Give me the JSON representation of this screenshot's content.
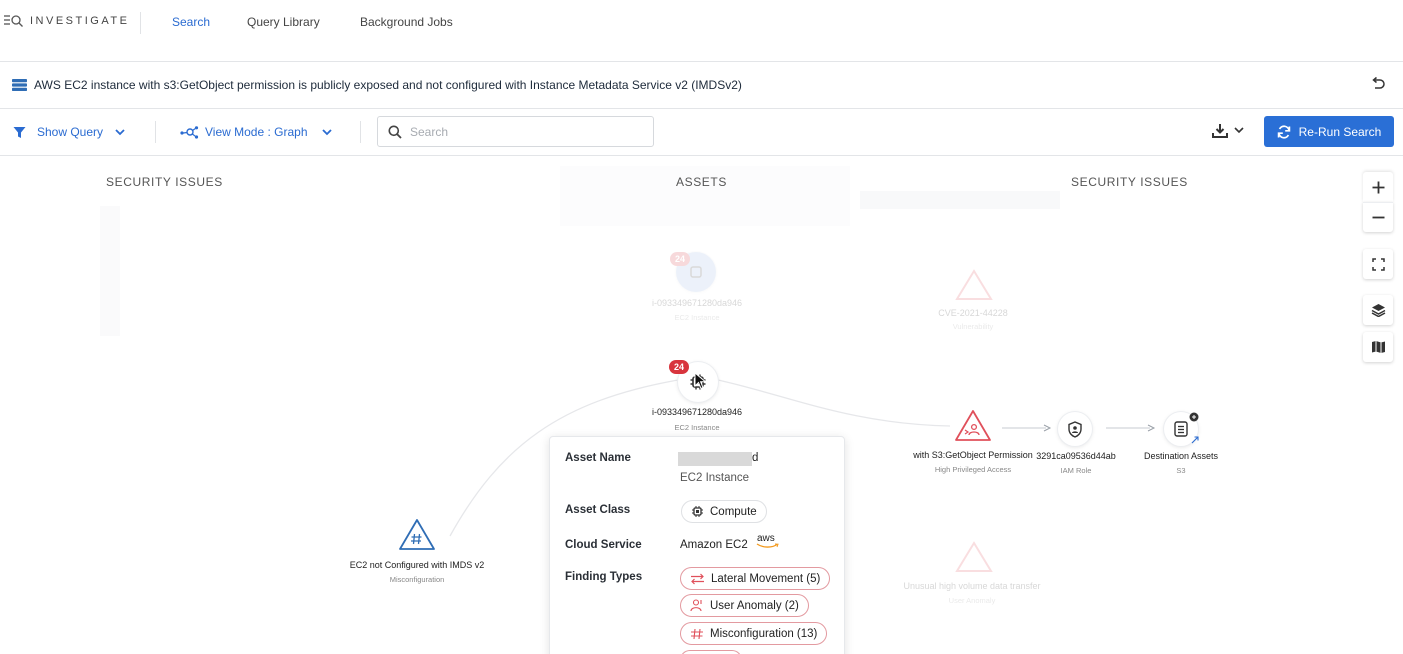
{
  "nav": {
    "brand": "INVESTIGATE",
    "tabs": [
      {
        "label": "Search",
        "active": true
      },
      {
        "label": "Query Library",
        "active": false
      },
      {
        "label": "Background Jobs",
        "active": false
      }
    ]
  },
  "title": {
    "text": "AWS EC2 instance with s3:GetObject permission is publicly exposed and not configured with Instance Metadata Service v2 (IMDSv2)"
  },
  "toolbar": {
    "show_query": "Show Query",
    "view_mode": "View Mode : Graph",
    "search_placeholder": "Search",
    "rerun_label": "Re-Run Search"
  },
  "columns": {
    "left": "SECURITY ISSUES",
    "center": "ASSETS",
    "right": "SECURITY ISSUES"
  },
  "graph": {
    "main_asset": {
      "badge": "24",
      "name": "i-093349671280da946",
      "type": "EC2 Instance"
    },
    "misconfig": {
      "name": "EC2 not Configured with IMDS v2",
      "type": "Misconfiguration"
    },
    "privilege": {
      "name": "with S3:GetObject Permission",
      "type": "High Privileged Access"
    },
    "iam_role": {
      "name": "3291ca09536d44ab",
      "type": "IAM Role"
    },
    "destination": {
      "name": "Destination Assets",
      "type": "S3"
    },
    "faded_asset": {
      "badge": "24",
      "name": "i-093349671280da946",
      "type": "EC2 Instance"
    },
    "faded_cve": {
      "name": "CVE-2021-44228",
      "type": "Vulnerability"
    },
    "faded_anomaly": {
      "name": "Unusual high volume data transfer",
      "type": "User Anomaly"
    }
  },
  "popup": {
    "asset_name_label": "Asset Name",
    "asset_name_suffix": "d",
    "asset_name_type": "EC2 Instance",
    "asset_class_label": "Asset Class",
    "asset_class_value": "Compute",
    "cloud_service_label": "Cloud Service",
    "cloud_service_value": "Amazon EC2",
    "cloud_logo_text": "aws",
    "finding_types_label": "Finding Types",
    "findings": [
      {
        "label": "Lateral Movement (5)",
        "icon": "arrows-swap-icon"
      },
      {
        "label": "User Anomaly (2)",
        "icon": "user-anomaly-icon"
      },
      {
        "label": "Misconfiguration (13)",
        "icon": "misconfiguration-icon"
      }
    ]
  },
  "colors": {
    "accent": "#2a6fd6",
    "badge": "#d8343d",
    "issue_red": "#e0505b",
    "misconfig_blue": "#2f6db5"
  }
}
